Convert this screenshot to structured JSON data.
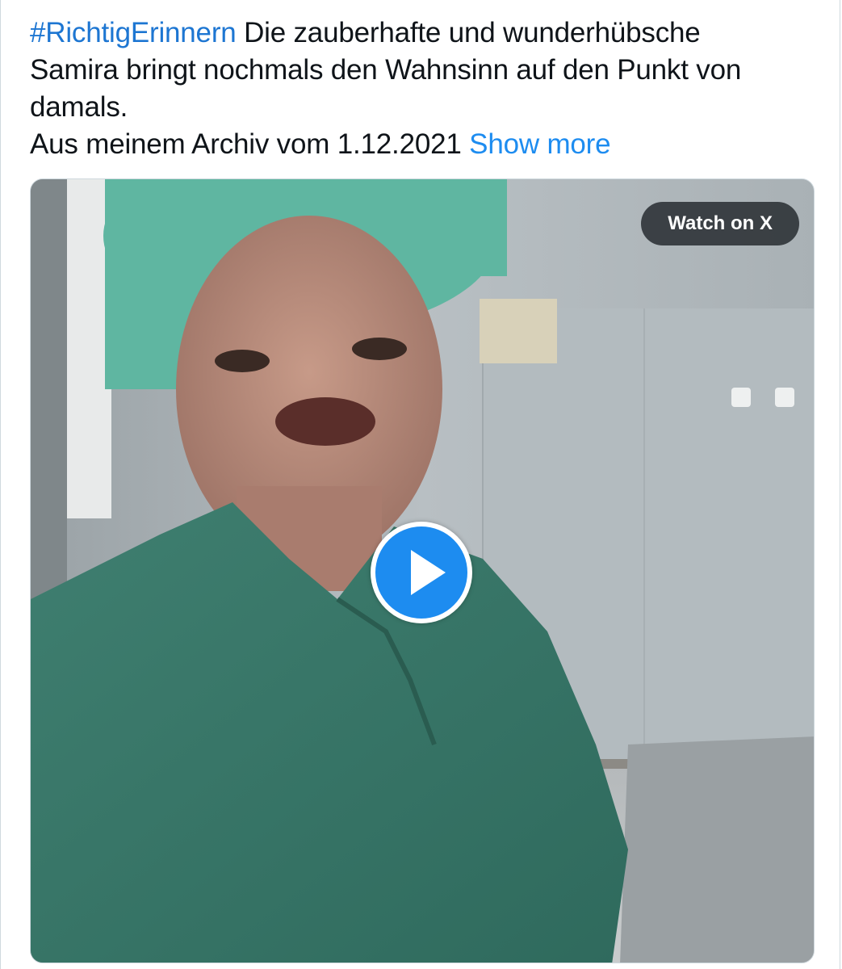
{
  "tweet": {
    "hashtag": "#RichtigErinnern",
    "line1_rest": " Die zauberhafte und wunderhübsche",
    "line2": "Samira bringt nochmals den Wahnsinn auf den Punkt von",
    "line3": "damals.",
    "line4": "Aus meinem Archiv vom 1.12.2021",
    "show_more": "Show more"
  },
  "video": {
    "watch_label": "Watch on X",
    "play_icon": "play-icon"
  },
  "colors": {
    "link": "#1d76d2",
    "show_more": "#1d8cf0",
    "play_button": "#1d8cf0",
    "watch_pill": "#272c30"
  }
}
